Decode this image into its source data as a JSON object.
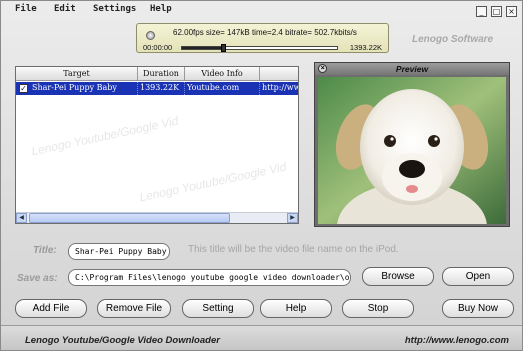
{
  "menu": [
    "File",
    "Edit",
    "Settings",
    "Help"
  ],
  "window_controls": [
    "_",
    "□",
    "×"
  ],
  "status": {
    "stats": "62.00fps size=  147kB time=2.4 bitrate= 502.7kbits/s",
    "time_start": "00:00:00",
    "time_end": "1393.22K",
    "progress": 0.27
  },
  "brand": "Lenogo Software",
  "list": {
    "columns": [
      "Target",
      "Duration",
      "Video Info",
      ""
    ],
    "rows": [
      {
        "checked": true,
        "target": "Shar-Pei Puppy Baby",
        "duration": "1393.22K",
        "info": "Youtube.com",
        "url": "http://ww"
      }
    ]
  },
  "watermarks": [
    "Lenogo Youtube/Google Vid",
    "Lenogo Youtube/Google Vid",
    "Lenogo Youtube/Google Vid"
  ],
  "preview": {
    "title": "Preview"
  },
  "form": {
    "title_label": "Title:",
    "title_value": "Shar-Pei Puppy Baby",
    "title_hint": "This title will be the video file name on the iPod.",
    "saveas_label": "Save as:",
    "saveas_value": "C:\\Program Files\\lenogo youtube google video downloader\\outp"
  },
  "buttons": {
    "browse": "Browse",
    "open": "Open",
    "add_file": "Add File",
    "remove_file": "Remove File",
    "setting": "Setting",
    "help": "Help",
    "stop": "Stop",
    "buy_now": "Buy Now"
  },
  "footer": {
    "app_name": "Lenogo Youtube/Google Video Downloader",
    "url": "http://www.lenogo.com"
  }
}
